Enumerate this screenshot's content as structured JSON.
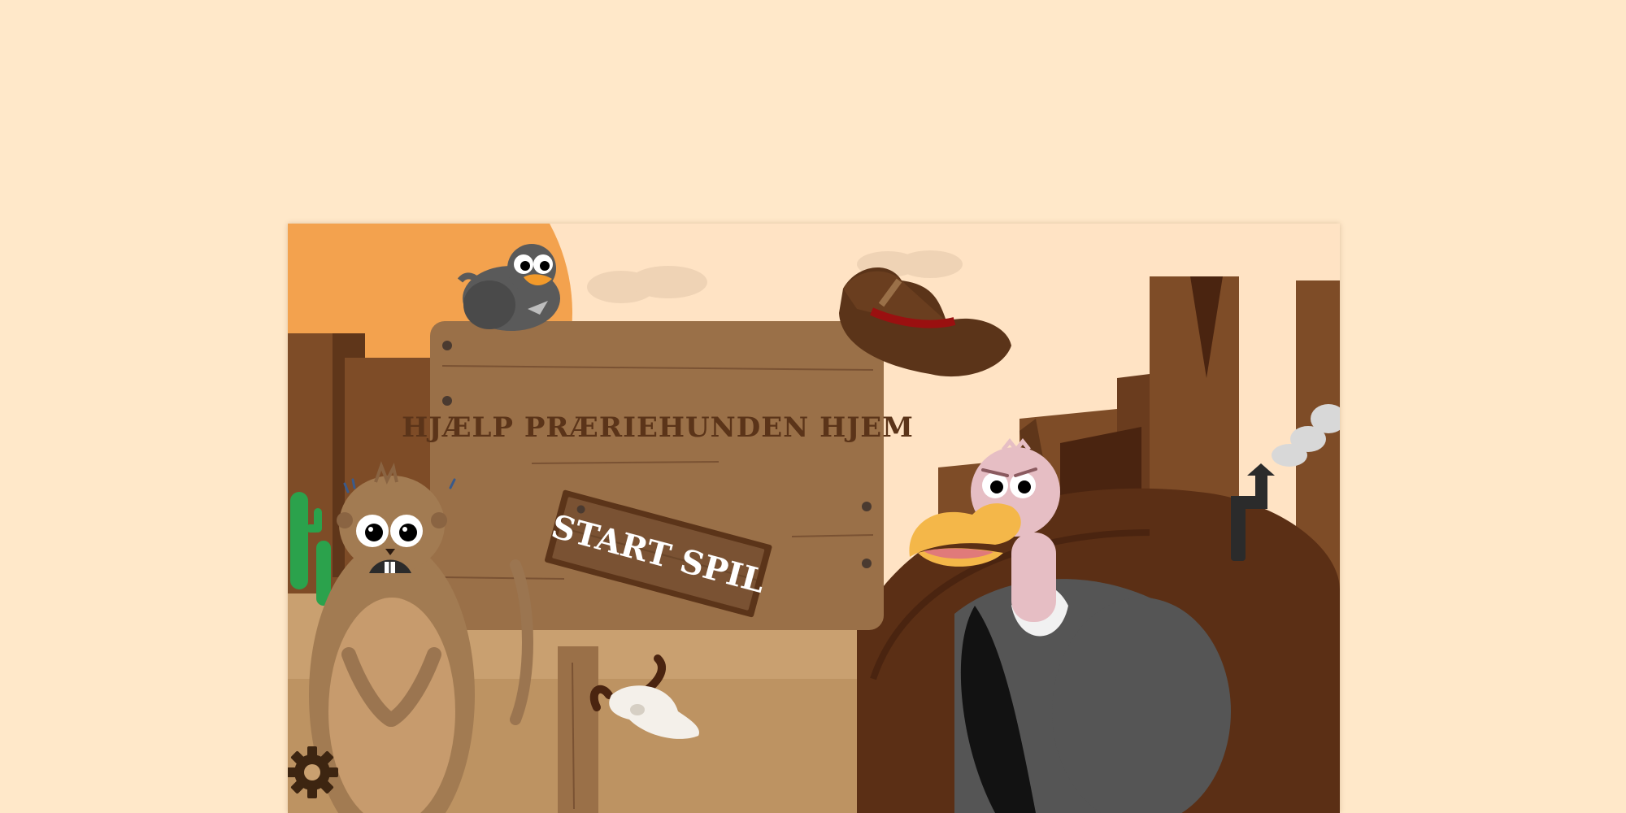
{
  "game": {
    "title": "HJÆLP PRÆRIEHUNDEN HJEM",
    "start_label": "START SPIL"
  },
  "icons": {
    "settings": "gear-icon"
  },
  "colors": {
    "page_background": "#ffe8c9",
    "sky": "#ffe3c4",
    "sun": "#f3a24e",
    "sign_wood": "#9a7048",
    "sign_text": "#5b3419",
    "start_plank": "#7a5233",
    "start_text": "#ffffff"
  }
}
